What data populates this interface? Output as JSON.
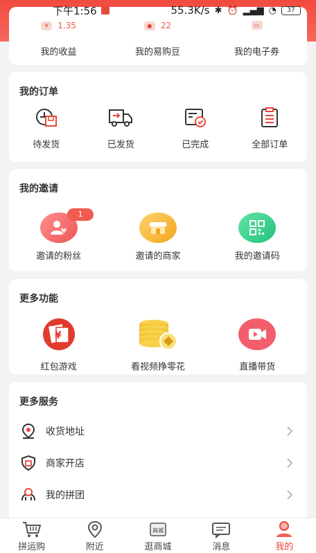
{
  "status": {
    "time": "下午1:56",
    "speed": "55.3K/s",
    "battery": "37"
  },
  "earnings": [
    {
      "value": "1.35",
      "label": "我的收益",
      "icon": "money-bag-icon"
    },
    {
      "value": "22",
      "label": "我的易购豆",
      "icon": "bean-icon"
    },
    {
      "value": "",
      "label": "我的电子券",
      "icon": "coupon-icon"
    }
  ],
  "orders": {
    "title": "我的订单",
    "items": [
      {
        "label": "待发货",
        "icon": "pending-shipment-icon"
      },
      {
        "label": "已发货",
        "icon": "truck-icon"
      },
      {
        "label": "已完成",
        "icon": "completed-icon"
      },
      {
        "label": "全部订单",
        "icon": "clipboard-icon"
      }
    ]
  },
  "invites": {
    "title": "我的邀请",
    "badge": "1",
    "items": [
      {
        "label": "邀请的粉丝",
        "icon": "fans-icon",
        "color": "#f26a6a"
      },
      {
        "label": "邀请的商家",
        "icon": "shop-icon",
        "color": "#f8b53a"
      },
      {
        "label": "我的邀请码",
        "icon": "qrcode-icon",
        "color": "#3ed393"
      }
    ]
  },
  "features": {
    "title": "更多功能",
    "items": [
      {
        "label": "红包游戏",
        "icon": "red-envelope-icon"
      },
      {
        "label": "看视频挣零花",
        "icon": "coins-icon"
      },
      {
        "label": "直播带货",
        "icon": "live-video-icon"
      }
    ]
  },
  "services": {
    "title": "更多服务",
    "items": [
      {
        "label": "收货地址",
        "icon": "location-pin-icon"
      },
      {
        "label": "商家开店",
        "icon": "shop-shield-icon"
      },
      {
        "label": "我的拼团",
        "icon": "group-icon"
      }
    ]
  },
  "tabs": [
    {
      "label": "拼运购",
      "icon": "cart-icon"
    },
    {
      "label": "附近",
      "icon": "nearby-icon"
    },
    {
      "label": "逛商城",
      "icon": "mall-icon",
      "icon_text": "商城"
    },
    {
      "label": "消息",
      "icon": "message-icon"
    },
    {
      "label": "我的",
      "icon": "profile-icon"
    }
  ],
  "colors": {
    "accent": "#e9473b",
    "header": "#f24a3f"
  }
}
